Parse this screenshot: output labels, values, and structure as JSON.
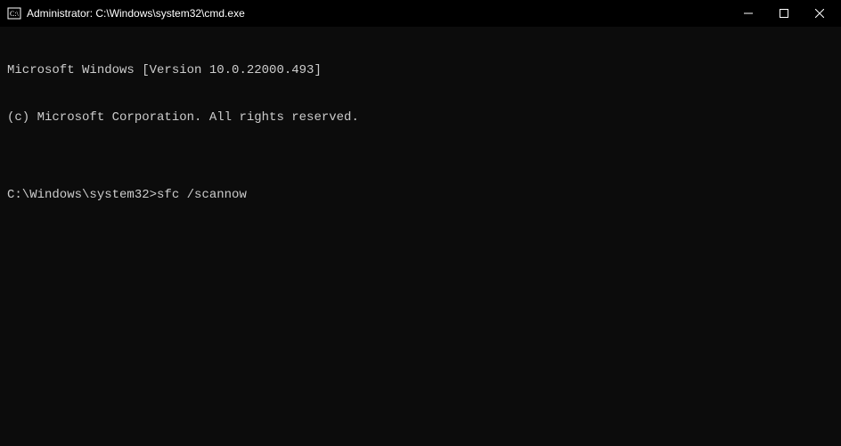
{
  "titleBar": {
    "title": "Administrator: C:\\Windows\\system32\\cmd.exe"
  },
  "terminal": {
    "line1": "Microsoft Windows [Version 10.0.22000.493]",
    "line2": "(c) Microsoft Corporation. All rights reserved.",
    "blank": "",
    "prompt": "C:\\Windows\\system32>",
    "command": "sfc /scannow"
  }
}
